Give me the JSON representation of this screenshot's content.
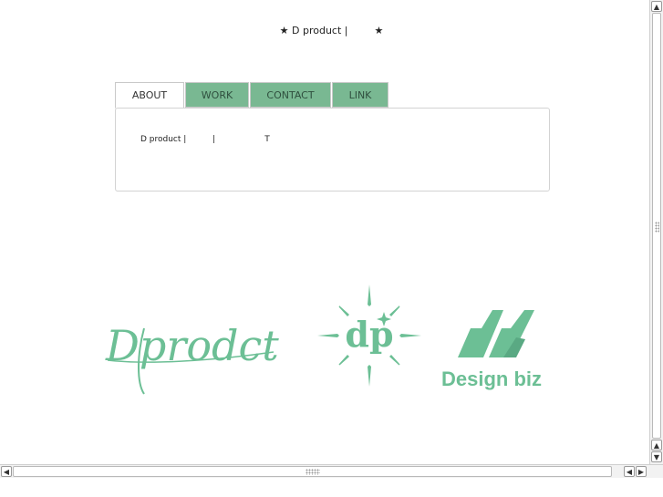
{
  "header": {
    "star_left": "★",
    "title": "D product |",
    "star_right": "★"
  },
  "tabs": [
    {
      "label": "ABOUT",
      "active": true
    },
    {
      "label": "WORK",
      "active": false
    },
    {
      "label": "CONTACT",
      "active": false
    },
    {
      "label": "LINK",
      "active": false
    }
  ],
  "panel": {
    "text": "D product |          |                   T"
  },
  "logos": {
    "script_logo": "Dprodct",
    "emblem_logo": "dp",
    "monogram_logo": "db",
    "monogram_caption": "Design biz",
    "brand_color": "#6cbf95"
  },
  "scrollbars": {
    "up_arrow": "▲",
    "down_arrow": "▼",
    "left_arrow": "◀",
    "right_arrow": "▶"
  }
}
